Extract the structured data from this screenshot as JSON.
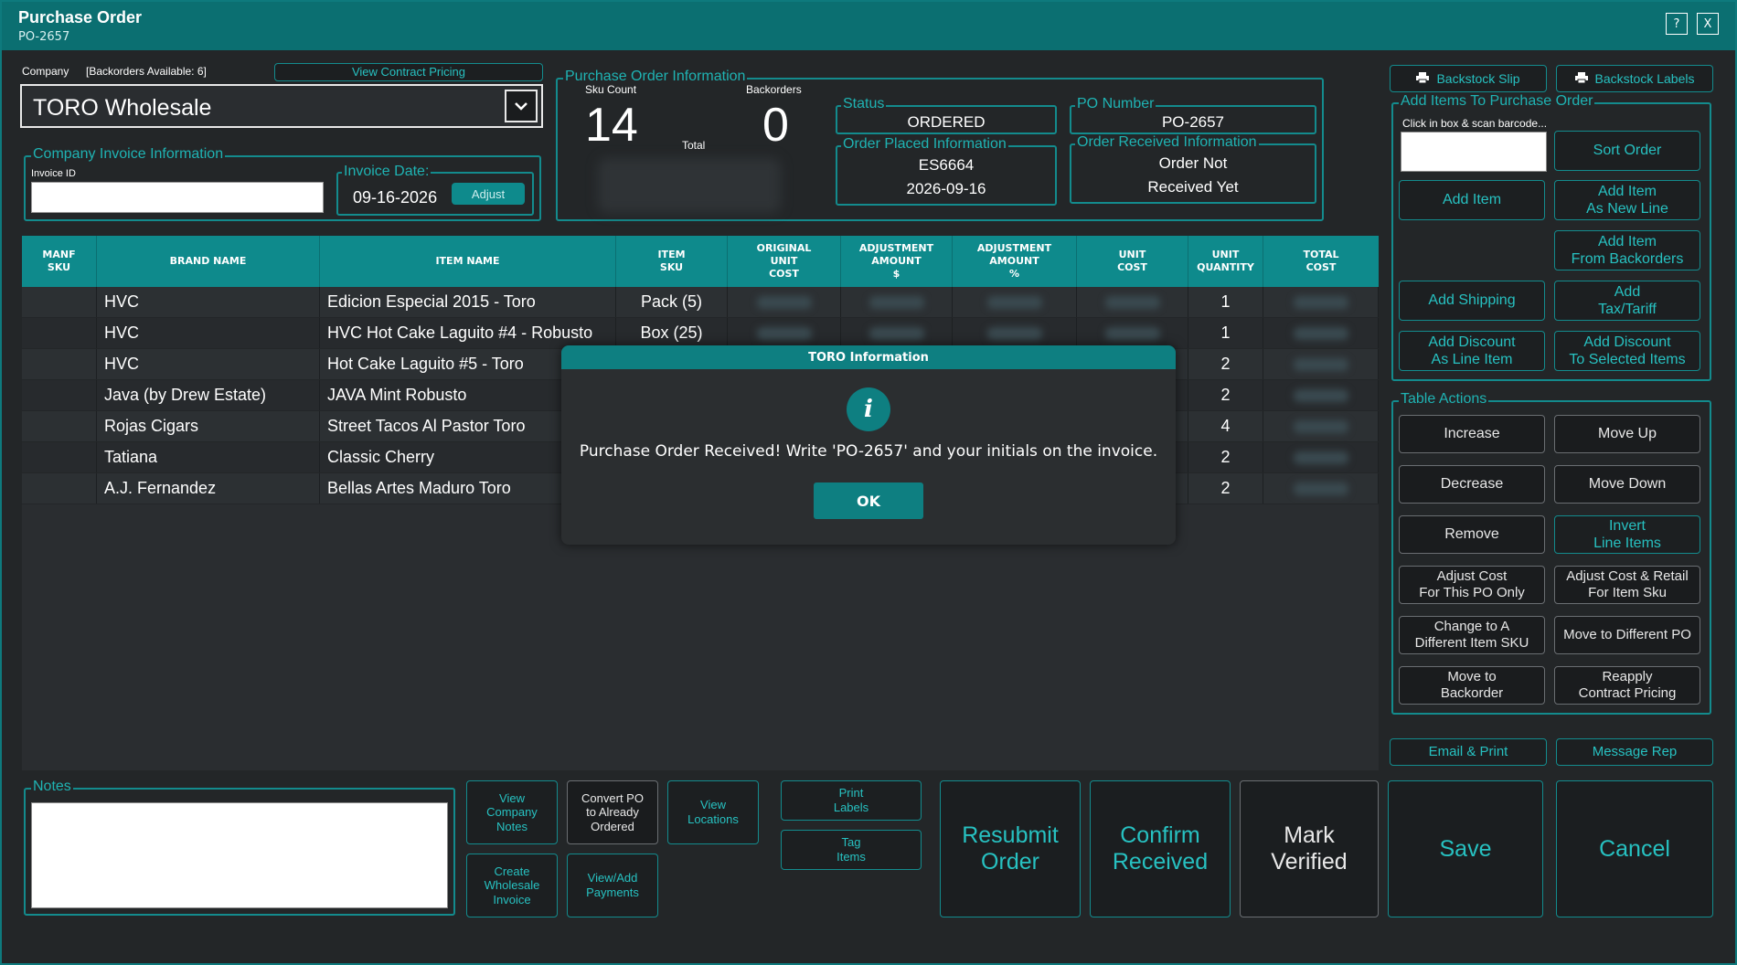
{
  "window": {
    "title": "Purchase Order",
    "subtitle": "PO-2657",
    "help_label": "?",
    "close_label": "X"
  },
  "company": {
    "label": "Company",
    "backorders_note": "[Backorders Available: 6]",
    "contract_pricing_label": "View Contract Pricing",
    "selected": "TORO Wholesale"
  },
  "invoice": {
    "legend": "Company Invoice Information",
    "id_label": "Invoice ID",
    "id_value": "",
    "date_legend": "Invoice Date:",
    "date_value": "09-16-2026",
    "adjust_label": "Adjust"
  },
  "po_info": {
    "legend": "Purchase Order Information",
    "sku_count_label": "Sku Count",
    "sku_count": "14",
    "backorders_label": "Backorders",
    "backorders": "0",
    "total_label": "Total",
    "status_legend": "Status",
    "status": "ORDERED",
    "po_number_legend": "PO Number",
    "po_number": "PO-2657",
    "placed_legend": "Order Placed Information",
    "placed_line1": "ES6664",
    "placed_line2": "2026-09-16",
    "received_legend": "Order Received Information",
    "received_line1": "Order Not",
    "received_line2": "Received Yet"
  },
  "table": {
    "headers": [
      "MANF\nSKU",
      "BRAND NAME",
      "ITEM NAME",
      "ITEM\nSKU",
      "ORIGINAL\nUNIT\nCOST",
      "ADJUSTMENT\nAMOUNT\n$",
      "ADJUSTMENT\nAMOUNT\n%",
      "UNIT\nCOST",
      "UNIT\nQUANTITY",
      "TOTAL\nCOST"
    ],
    "rows": [
      {
        "brand": "HVC",
        "item": "Edicion Especial 2015 - Toro",
        "sku": "Pack (5)",
        "qty": "1"
      },
      {
        "brand": "HVC",
        "item": "HVC Hot Cake Laguito #4 - Robusto",
        "sku": "Box (25)",
        "qty": "1"
      },
      {
        "brand": "HVC",
        "item": "Hot Cake Laguito #5 - Toro",
        "sku": "",
        "qty": "2"
      },
      {
        "brand": "Java (by Drew Estate)",
        "item": "JAVA Mint Robusto",
        "sku": "",
        "qty": "2"
      },
      {
        "brand": "Rojas Cigars",
        "item": "Street Tacos Al Pastor Toro",
        "sku": "",
        "qty": "4"
      },
      {
        "brand": "Tatiana",
        "item": "Classic Cherry",
        "sku": "",
        "qty": "2"
      },
      {
        "brand": "A.J. Fernandez",
        "item": "Bellas Artes Maduro Toro",
        "sku": "",
        "qty": "2"
      }
    ]
  },
  "right_panel": {
    "backstock_slip": "Backstock Slip",
    "backstock_labels": "Backstock Labels",
    "add_items_legend": "Add Items To Purchase Order",
    "scan_hint": "Click in box & scan barcode...",
    "scan_value": "",
    "sort_order": "Sort Order",
    "add_item": "Add Item",
    "add_item_new_line": "Add Item\nAs New Line",
    "add_item_backorders": "Add Item\nFrom Backorders",
    "add_shipping": "Add Shipping",
    "add_tax": "Add\nTax/Tariff",
    "add_discount_line": "Add Discount\nAs Line Item",
    "add_discount_selected": "Add Discount\nTo Selected Items",
    "table_actions_legend": "Table Actions",
    "increase": "Increase",
    "move_up": "Move Up",
    "decrease": "Decrease",
    "move_down": "Move Down",
    "remove": "Remove",
    "invert": "Invert\nLine Items",
    "adjust_cost_po": "Adjust Cost\nFor This PO Only",
    "adjust_cost_retail": "Adjust Cost & Retail\nFor Item Sku",
    "change_sku": "Change to A\nDifferent Item SKU",
    "move_po": "Move to Different PO",
    "move_backorder": "Move to\nBackorder",
    "reapply": "Reapply\nContract Pricing",
    "email_print": "Email & Print",
    "message_rep": "Message Rep"
  },
  "notes": {
    "legend": "Notes",
    "value": ""
  },
  "bottom": {
    "view_company_notes": "View\nCompany\nNotes",
    "convert_po": "Convert PO\nto Already\nOrdered",
    "view_locations": "View\nLocations",
    "create_wholesale_invoice": "Create\nWholesale\nInvoice",
    "view_add_payments": "View/Add\nPayments",
    "print_labels": "Print\nLabels",
    "tag_items": "Tag\nItems",
    "resubmit_order": "Resubmit\nOrder",
    "confirm_received": "Confirm\nReceived",
    "mark_verified": "Mark\nVerified",
    "save": "Save",
    "cancel": "Cancel"
  },
  "modal": {
    "title": "TORO Information",
    "icon": "info-icon",
    "message": "Purchase Order Received! Write 'PO-2657' and your initials on the invoice.",
    "ok_label": "OK"
  },
  "colors": {
    "accent": "#0e8a8c",
    "background": "#232628"
  }
}
